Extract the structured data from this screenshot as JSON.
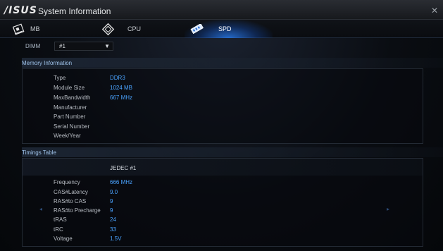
{
  "app": {
    "logo": "/ISUS",
    "title": "System Information",
    "close": "✕"
  },
  "tabs": [
    {
      "label": "MB",
      "icon": "motherboard-icon"
    },
    {
      "label": "CPU",
      "icon": "cpu-icon"
    },
    {
      "label": "SPD",
      "icon": "memory-stick-icon",
      "active": true
    }
  ],
  "dimm": {
    "label": "DIMM",
    "value": "#1"
  },
  "memory_info": {
    "title": "Memory Information",
    "rows": [
      {
        "label": "Type",
        "value": "DDR3"
      },
      {
        "label": "Module Size",
        "value": "1024 MB"
      },
      {
        "label": "MaxBandwidth",
        "value": "667 MHz"
      },
      {
        "label": "Manufacturer",
        "value": ""
      },
      {
        "label": "Part Number",
        "value": ""
      },
      {
        "label": "Serial Number",
        "value": ""
      },
      {
        "label": "Week/Year",
        "value": ""
      }
    ]
  },
  "timings": {
    "title": "Timings Table",
    "column": "JEDEC #1",
    "rows": [
      {
        "label": "Frequency",
        "value": "666 MHz"
      },
      {
        "label": "CAS#Latency",
        "value": "9.0"
      },
      {
        "label": "RAS#to CAS",
        "value": "9"
      },
      {
        "label": "RAS#to Precharge",
        "value": "9"
      },
      {
        "label": "tRAS",
        "value": "24"
      },
      {
        "label": "tRC",
        "value": "33"
      },
      {
        "label": "Voltage",
        "value": "1.5V"
      }
    ]
  },
  "colors": {
    "accent": "#4aa3ff",
    "section_title": "#9fc3ea"
  }
}
